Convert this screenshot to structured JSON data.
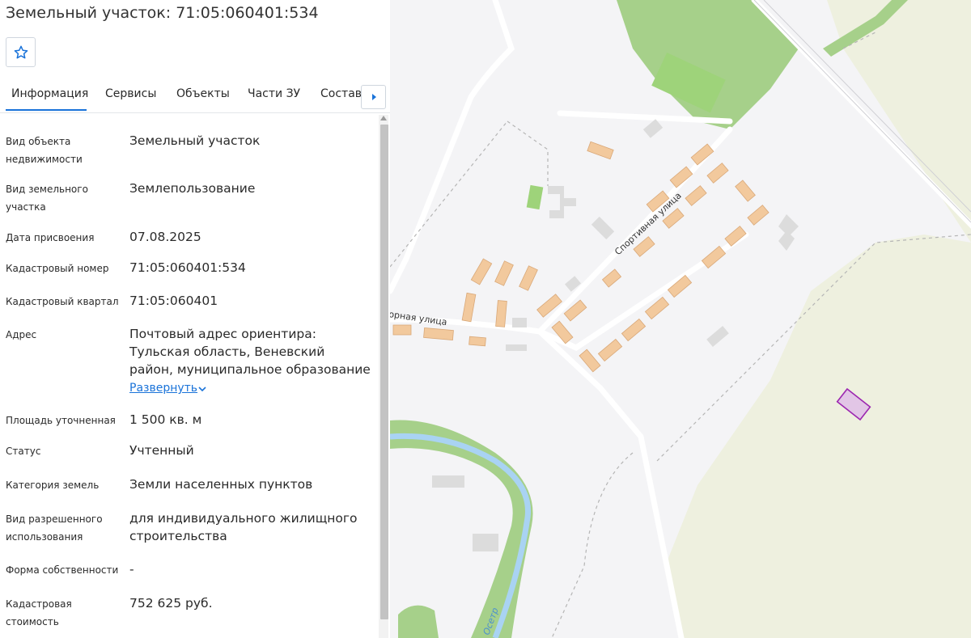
{
  "panel": {
    "title": "Земельный участок: 71:05:060401:534",
    "favorite_icon": "star-outline-icon",
    "tabs": [
      {
        "label": "Информация",
        "active": true
      },
      {
        "label": "Сервисы",
        "active": false
      },
      {
        "label": "Объекты",
        "active": false
      },
      {
        "label": "Части ЗУ",
        "active": false
      },
      {
        "label": "Состав",
        "active": false
      }
    ],
    "tabs_more_icon": "caret-right-icon",
    "fields": [
      {
        "label": "Вид объекта недвижимости",
        "value": "Земельный участок"
      },
      {
        "label": "Вид земельного участка",
        "value": "Землепользование"
      },
      {
        "label": "Дата присвоения",
        "value": "07.08.2025"
      },
      {
        "label": "Кадастровый номер",
        "value": "71:05:060401:534"
      },
      {
        "label": "Кадастровый квартал",
        "value": "71:05:060401"
      },
      {
        "label": "Адрес",
        "value": "Почтовый адрес ориентира: Тульская область, Веневский район, муниципальное образование"
      },
      {
        "label": "Площадь уточненная",
        "value": "1 500 кв. м"
      },
      {
        "label": "Статус",
        "value": "Учтенный"
      },
      {
        "label": "Категория земель",
        "value": "Земли населенных пунктов"
      },
      {
        "label": "Вид разрешенного использования",
        "value": "для индивидуального жилищного строительства"
      },
      {
        "label": "Форма собственности",
        "value": "-"
      },
      {
        "label": "Кадастровая стоимость",
        "value": "752 625 руб."
      }
    ],
    "expand_label": "Развернуть",
    "accent_color": "#1a73d9"
  },
  "map": {
    "street_labels": [
      "Спортивная улица",
      "орная улица"
    ],
    "river_label": "Осетр",
    "colors": {
      "background": "#f4f4f6",
      "forest": "#a6d08a",
      "field": "#eef0df",
      "water": "#a9d3f3",
      "house": "#f2c99d",
      "building_gray": "#dcdcdc",
      "parcel_outline": "#9c27b0",
      "parcel_fill": "#e2c6e6"
    }
  }
}
